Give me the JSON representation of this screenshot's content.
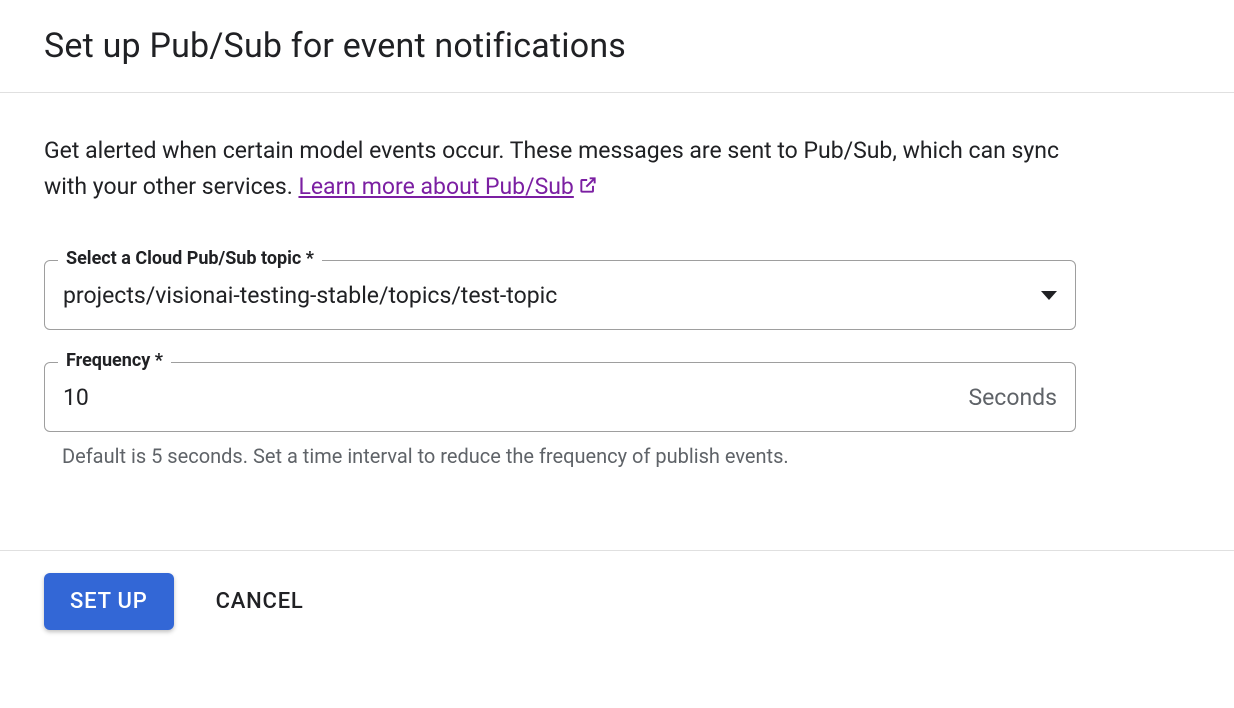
{
  "header": {
    "title": "Set up Pub/Sub for event notifications"
  },
  "intro": {
    "text_before": "Get alerted when certain model events occur. These messages are sent to Pub/Sub, which can sync with your other services. ",
    "link_text": "Learn more about Pub/Sub"
  },
  "fields": {
    "topic": {
      "label": "Select a Cloud Pub/Sub topic *",
      "value": "projects/visionai-testing-stable/topics/test-topic"
    },
    "frequency": {
      "label": "Frequency *",
      "value": "10",
      "suffix": "Seconds",
      "hint": "Default is 5 seconds. Set a time interval to reduce the frequency of publish events."
    }
  },
  "footer": {
    "submit": "Set up",
    "cancel": "Cancel"
  }
}
